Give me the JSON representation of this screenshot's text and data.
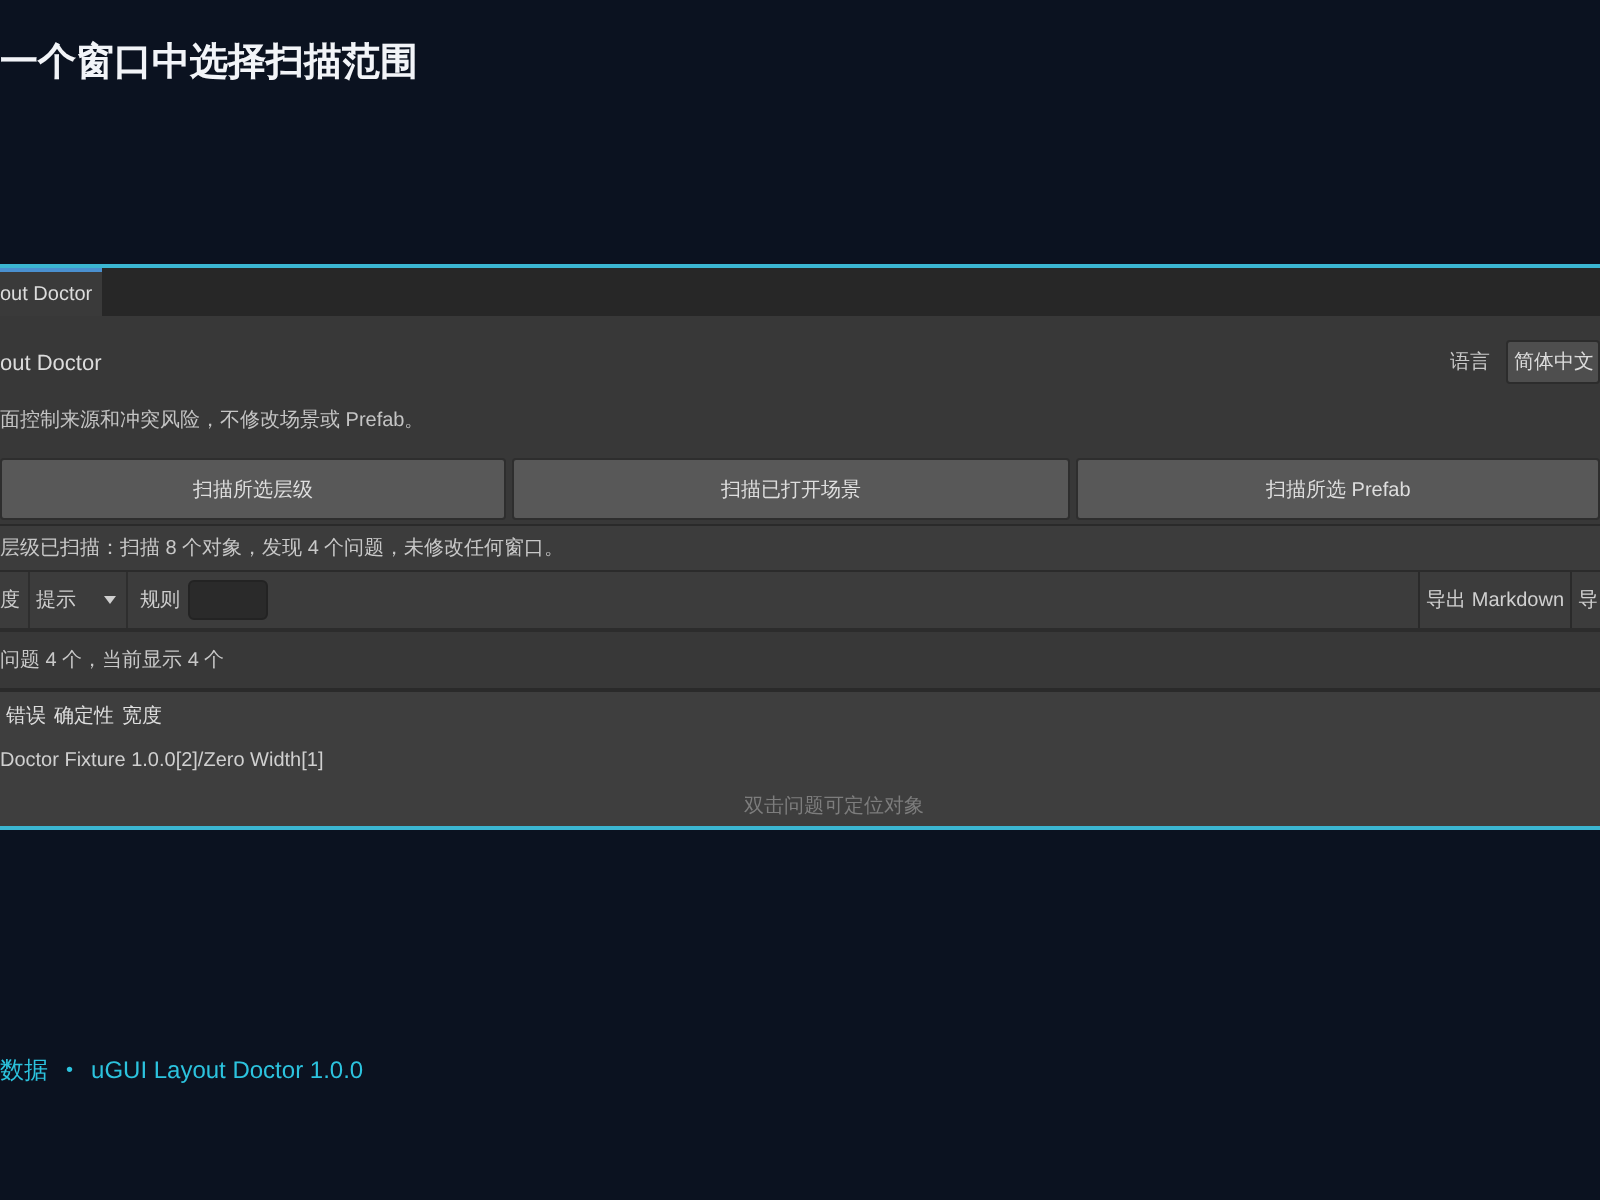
{
  "page": {
    "title": "一个窗口中选择扫描范围"
  },
  "window": {
    "tabs": [
      {
        "label": "out Doctor",
        "selected": true
      }
    ],
    "header": {
      "title": "out Doctor",
      "description": "面控制来源和冲突风险，不修改场景或 Prefab。"
    },
    "language": {
      "label": "语言",
      "value": "简体中文"
    },
    "scan_buttons": [
      "扫描所选层级",
      "扫描已打开场景",
      "扫描所选 Prefab"
    ],
    "status": "层级已扫描：扫描 8 个对象，发现 4 个问题，未修改任何窗口。",
    "filters": {
      "severity_label": "度",
      "severity_value": "提示",
      "rule_label": "规则"
    },
    "export_buttons": [
      "导出 Markdown",
      "导"
    ],
    "summary": "问题 4 个，当前显示 4 个",
    "issues": {
      "tags": [
        "错误",
        "确定性",
        "宽度"
      ],
      "rows": [
        "Doctor Fixture 1.0.0[2]/Zero Width[1]"
      ],
      "hint": "双击问题可定位对象"
    }
  },
  "footer": {
    "items": [
      "数据",
      "uGUI Layout Doctor 1.0.0"
    ],
    "separator": "•"
  }
}
